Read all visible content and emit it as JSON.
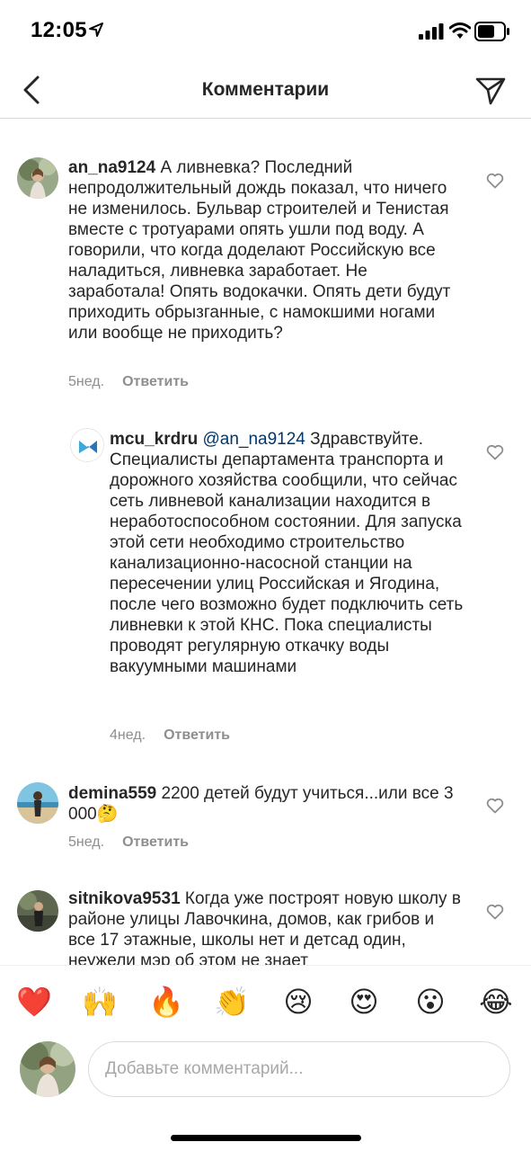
{
  "status_bar": {
    "time": "12:05"
  },
  "nav": {
    "title": "Комментарии"
  },
  "comments": [
    {
      "username": "an_na9124",
      "text": " А ливневка? Последний непродолжительный дождь показал, что ничего не изменилось. Бульвар строителей и Тенистая вместе с тротуарами опять ушли под воду. А говорили, что когда доделают Российскую все наладиться, ливневка заработает. Не заработала! Опять водокачки. Опять дети будут приходить обрызганные, с намокшими ногами или вообще не приходить?",
      "age": "5нед.",
      "reply_label": "Ответить"
    },
    {
      "username": "mcu_krdru",
      "mention": " @an_na9124",
      "text": " Здравствуйте. Специалисты департамента транспорта и дорожного хозяйства сообщили, что сейчас сеть ливневой канализации находится в неработоспособном состоянии. Для запуска этой сети необходимо строительство канализационно-насосной станции на пересечении улиц Российская и Ягодина, после чего возможно будет подключить сеть ливневки к этой КНС. Пока специалисты проводят регулярную откачку воды вакуумными машинами",
      "age": "4нед.",
      "reply_label": "Ответить"
    },
    {
      "username": "demina559",
      "text": " 2200 детей будут учиться...или все 3 000🤔",
      "age": "5нед.",
      "reply_label": "Ответить"
    },
    {
      "username": "sitnikova9531",
      "text": " Когда уже построят новую школу в районе улицы Лавочкина, домов, как грибов и все 17 этажные, школы нет и детсад один, неужели мэр об этом не знает"
    }
  ],
  "emoji_bar": [
    "❤️",
    "🙌",
    "🔥",
    "👏",
    "😢",
    "😍",
    "😮",
    "😂"
  ],
  "composer": {
    "placeholder": "Добавьте комментарий..."
  },
  "colors": {
    "text": "#262626",
    "secondary": "#8e8e8e",
    "mention": "#00376b",
    "border": "#dbdbdb"
  }
}
